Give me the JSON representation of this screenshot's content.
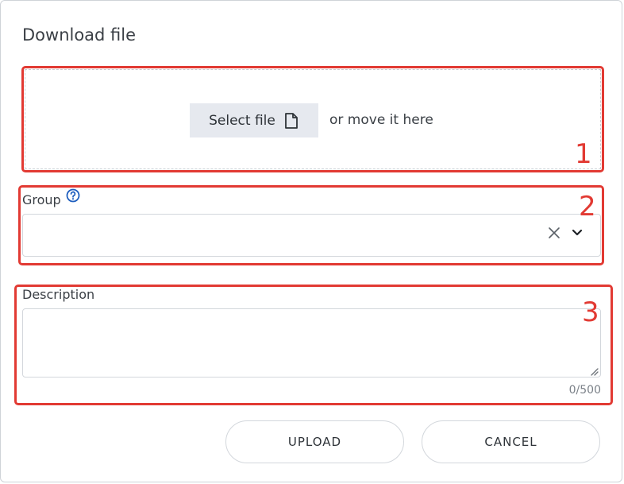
{
  "dialog": {
    "title": "Download file"
  },
  "dropzone": {
    "select_label": "Select file",
    "select_icon": "file-icon",
    "hint": "or move it here"
  },
  "group": {
    "label": "Group",
    "help_icon": "question-circle-icon",
    "value": "",
    "clear_icon": "close-icon",
    "expand_icon": "chevron-down-icon"
  },
  "description": {
    "label": "Description",
    "value": "",
    "counter": "0/500"
  },
  "actions": {
    "upload_label": "UPLOAD",
    "cancel_label": "CANCEL"
  },
  "annotations": {
    "one": "1",
    "two": "2",
    "three": "3",
    "color": "#e23a33"
  },
  "colors": {
    "help_icon": "#1f5fbf",
    "select_button_bg": "#e6e9ef"
  }
}
